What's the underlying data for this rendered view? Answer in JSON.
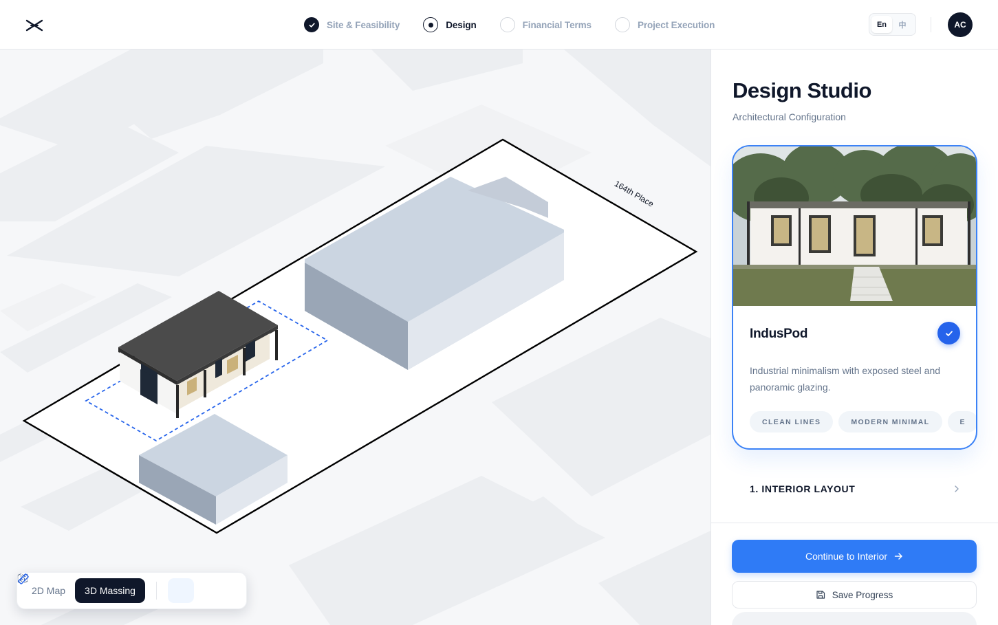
{
  "header": {
    "steps": [
      {
        "label": "Site & Feasibility",
        "state": "done"
      },
      {
        "label": "Design",
        "state": "current"
      },
      {
        "label": "Financial Terms",
        "state": "upcoming"
      },
      {
        "label": "Project Execution",
        "state": "upcoming"
      }
    ],
    "language": {
      "options": [
        "En",
        "中"
      ],
      "selected": "En"
    },
    "avatar_initials": "AC"
  },
  "map": {
    "street_label": "164th Place",
    "view_controls": {
      "map2d_label": "2D Map",
      "massing3d_label": "3D Massing",
      "selected": "3D Massing"
    }
  },
  "panel": {
    "title": "Design Studio",
    "subtitle": "Architectural Configuration",
    "card": {
      "name": "IndusPod",
      "selected": true,
      "description": "Industrial minimalism with exposed steel and panoramic glazing.",
      "tags": [
        "CLEAN LINES",
        "MODERN MINIMAL",
        "E"
      ]
    },
    "section_1": "1. INTERIOR LAYOUT",
    "primary_button": "Continue to Interior",
    "secondary_button": "Save Progress"
  },
  "colors": {
    "accent": "#2f7bf6",
    "dark": "#0f172a",
    "muted": "#94a3b8",
    "massing": "#cbd5e1"
  }
}
